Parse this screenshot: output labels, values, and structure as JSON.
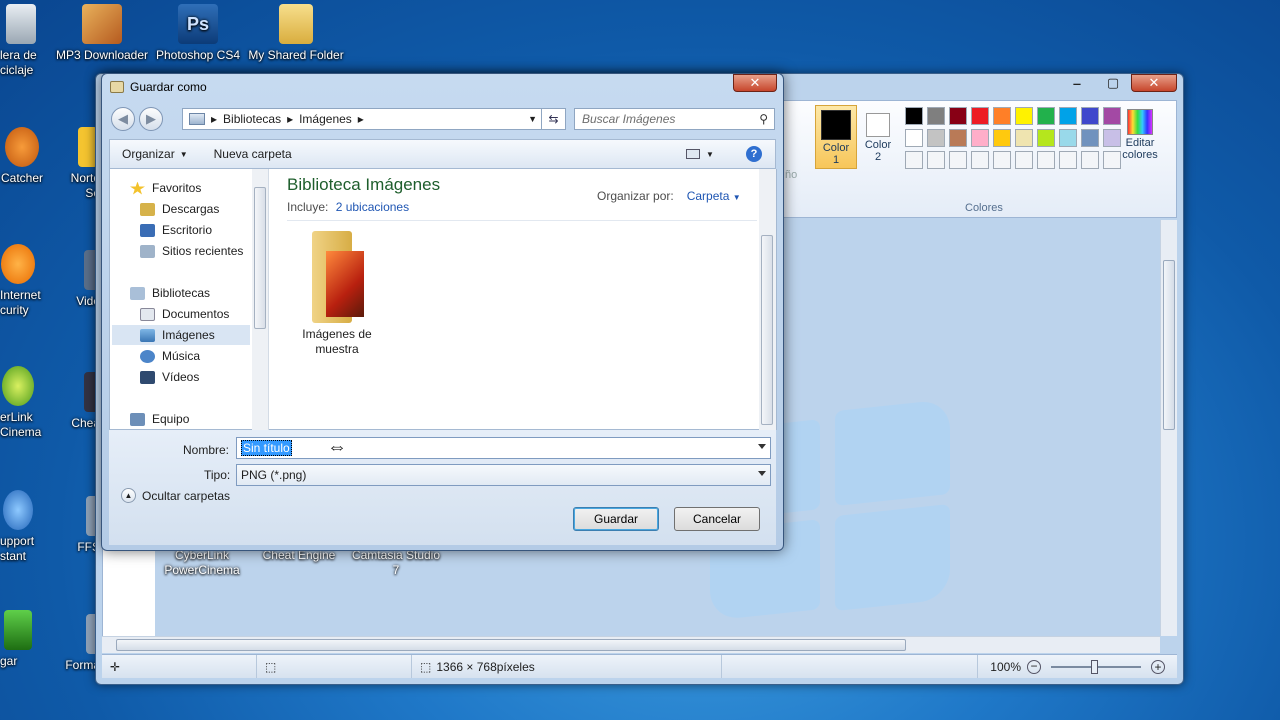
{
  "desktop": {
    "icons": [
      {
        "label": "lera de\nciclaje",
        "icon": "recycle-bin-icon"
      },
      {
        "label": "MP3 Downloader",
        "icon": "package-icon"
      },
      {
        "label": "Photoshop CS4",
        "icon": "photoshop-icon"
      },
      {
        "label": "My Shared Folder",
        "icon": "folder-icon"
      },
      {
        "label": "Catcher",
        "icon": "app-icon"
      },
      {
        "label": "Norto\nSe",
        "icon": "norton-icon"
      },
      {
        "label": "Internet\ncurity",
        "icon": "avast-icon"
      },
      {
        "label": "Vide",
        "icon": "video-icon"
      },
      {
        "label": "erLink\nCinema",
        "icon": "cyberlink-icon"
      },
      {
        "label": "Chea",
        "icon": "cheat-engine-icon"
      },
      {
        "label": "upport\nstant",
        "icon": "support-icon"
      },
      {
        "label": "FFS",
        "icon": "ffs-icon"
      },
      {
        "label": "gar",
        "icon": "games-icon"
      },
      {
        "label": "Forma",
        "icon": "format-icon"
      },
      {
        "label": "CyberLink\nPowerCinema",
        "icon": "cyberlink-icon"
      },
      {
        "label": "Cheat Engine",
        "icon": "cheat-engine-icon"
      },
      {
        "label": "Camtasia Studio\n7",
        "icon": "camtasia-icon"
      }
    ]
  },
  "paint": {
    "ribbon": {
      "color1_label": "Color\n1",
      "color2_label": "Color\n2",
      "edit_colors_label": "Editar\ncolores",
      "group_label": "Colores",
      "partial_label": "ño",
      "palette_row1": [
        "#000000",
        "#7f7f7f",
        "#880015",
        "#ed1c24",
        "#ff7f27",
        "#fff200",
        "#22b14c",
        "#00a2e8",
        "#3f48cc",
        "#a349a4"
      ],
      "palette_row2": [
        "#ffffff",
        "#c3c3c3",
        "#b97a57",
        "#ffaec9",
        "#ffc90e",
        "#efe4b0",
        "#b5e61d",
        "#99d9ea",
        "#7092be",
        "#c8bfe7"
      ]
    },
    "status": {
      "dimensions": "1366 × 768píxeles",
      "zoom": "100%"
    }
  },
  "dialog": {
    "title": "Guardar como",
    "address": {
      "crumb1": "Bibliotecas",
      "crumb2": "Imágenes"
    },
    "search_placeholder": "Buscar Imágenes",
    "toolbar": {
      "organize": "Organizar",
      "new_folder": "Nueva carpeta"
    },
    "nav": {
      "favorites": "Favoritos",
      "downloads": "Descargas",
      "desktop": "Escritorio",
      "recent": "Sitios recientes",
      "libraries": "Bibliotecas",
      "documents": "Documentos",
      "images": "Imágenes",
      "music": "Música",
      "videos": "Vídeos",
      "computer": "Equipo"
    },
    "library": {
      "title": "Biblioteca Imágenes",
      "includes_label": "Incluye:",
      "includes_link": "2 ubicaciones",
      "arrange_label": "Organizar por:",
      "arrange_value": "Carpeta"
    },
    "folder_item": "Imágenes de\nmuestra",
    "name_label": "Nombre:",
    "name_value": "Sin título",
    "type_label": "Tipo:",
    "type_value": "PNG (*.png)",
    "hide_folders": "Ocultar carpetas",
    "save_button": "Guardar",
    "cancel_button": "Cancelar"
  }
}
